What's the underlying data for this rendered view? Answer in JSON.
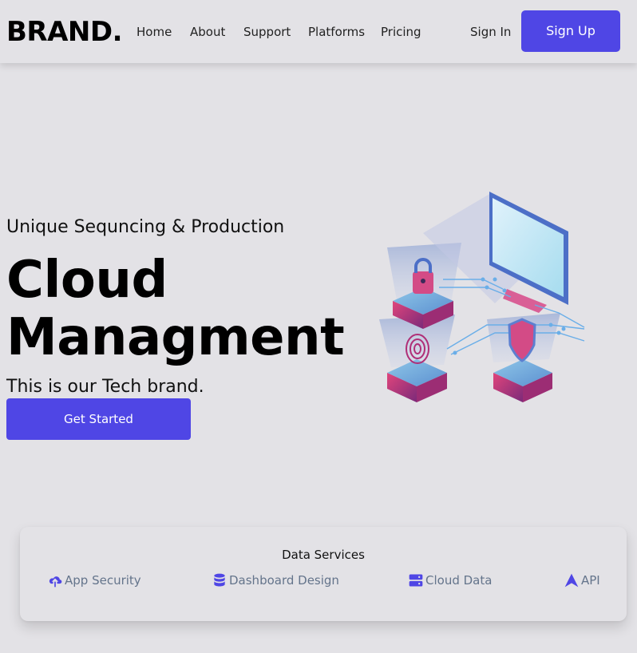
{
  "nav": {
    "brand": "BRAND.",
    "links": [
      "Home",
      "About",
      "Support",
      "Platforms",
      "Pricing"
    ],
    "sign_in": "Sign In",
    "sign_up": "Sign Up"
  },
  "hero": {
    "tagline": "Unique Sequncing & Production",
    "title_line1": "Cloud",
    "title_line2": "Managment",
    "subtitle": "This is our Tech brand.",
    "cta": "Get Started",
    "illustration": "cloud-security-isometric-illustration"
  },
  "services": {
    "title": "Data Services",
    "items": [
      {
        "label": "App Security",
        "icon": "cloud-upload-icon"
      },
      {
        "label": "Dashboard Design",
        "icon": "database-icon"
      },
      {
        "label": "Cloud Data",
        "icon": "server-icon"
      },
      {
        "label": "API",
        "icon": "api-arrow-icon"
      }
    ]
  },
  "colors": {
    "accent": "#4f46e5",
    "background": "#e3e2e6",
    "muted_text": "#64748b"
  }
}
